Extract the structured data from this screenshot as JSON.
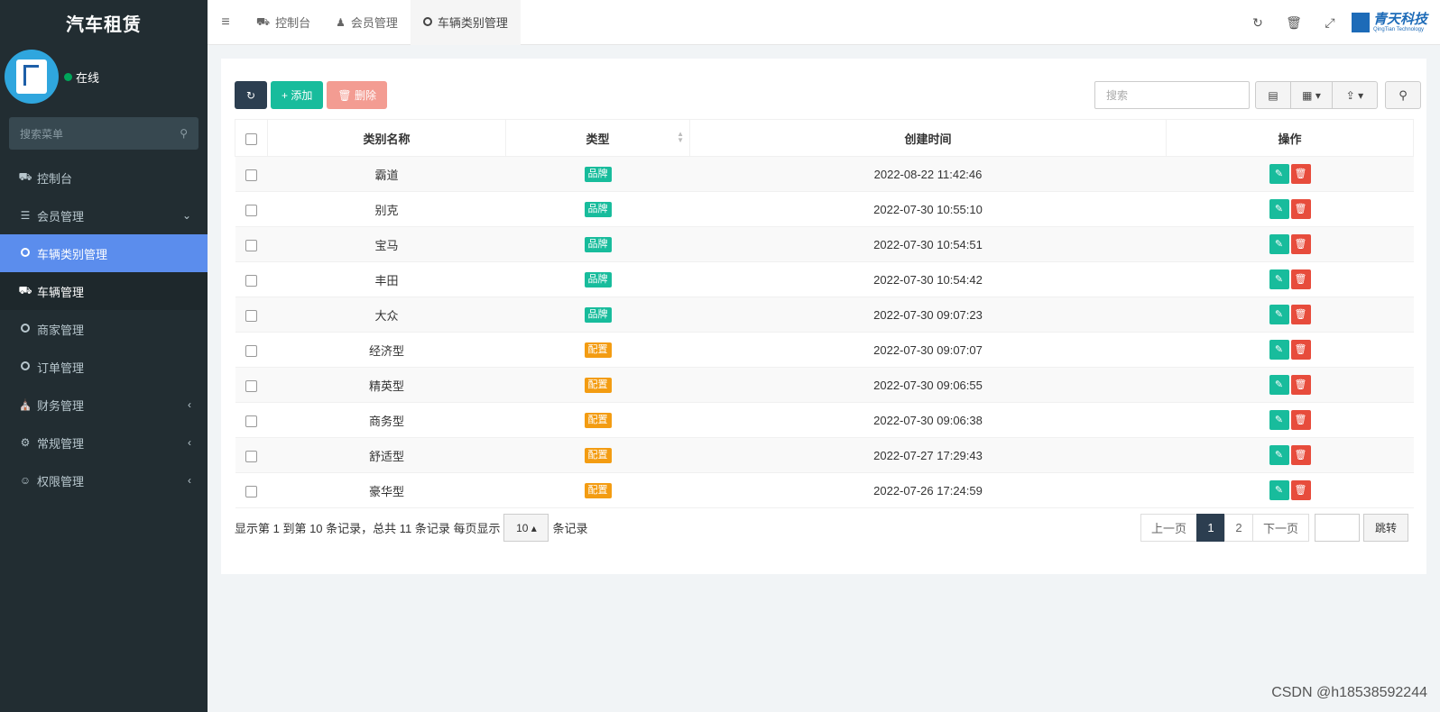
{
  "sidebar": {
    "brand": "汽车租赁",
    "status": "在线",
    "search_placeholder": "搜索菜单",
    "items": [
      {
        "label": "控制台"
      },
      {
        "label": "会员管理"
      },
      {
        "label": "车辆类别管理"
      },
      {
        "label": "车辆管理"
      },
      {
        "label": "商家管理"
      },
      {
        "label": "订单管理"
      },
      {
        "label": "财务管理"
      },
      {
        "label": "常规管理"
      },
      {
        "label": "权限管理"
      }
    ]
  },
  "topbar": {
    "tabs": [
      {
        "label": "控制台"
      },
      {
        "label": "会员管理"
      },
      {
        "label": "车辆类别管理"
      }
    ],
    "brand_name": "青天科技",
    "brand_en": "QingTian Technology"
  },
  "toolbar": {
    "add_label": "添加",
    "delete_label": "删除",
    "search_placeholder": "搜索"
  },
  "table": {
    "headers": [
      "类别名称",
      "类型",
      "创建时间",
      "操作"
    ],
    "rows": [
      {
        "name": "霸道",
        "type": "品牌",
        "time": "2022-08-22 11:42:46"
      },
      {
        "name": "别克",
        "type": "品牌",
        "time": "2022-07-30 10:55:10"
      },
      {
        "name": "宝马",
        "type": "品牌",
        "time": "2022-07-30 10:54:51"
      },
      {
        "name": "丰田",
        "type": "品牌",
        "time": "2022-07-30 10:54:42"
      },
      {
        "name": "大众",
        "type": "品牌",
        "time": "2022-07-30 09:07:23"
      },
      {
        "name": "经济型",
        "type": "配置",
        "time": "2022-07-30 09:07:07"
      },
      {
        "name": "精英型",
        "type": "配置",
        "time": "2022-07-30 09:06:55"
      },
      {
        "name": "商务型",
        "type": "配置",
        "time": "2022-07-30 09:06:38"
      },
      {
        "name": "舒适型",
        "type": "配置",
        "time": "2022-07-27 17:29:43"
      },
      {
        "name": "豪华型",
        "type": "配置",
        "time": "2022-07-26 17:24:59"
      }
    ],
    "type_colors": {
      "品牌": "#18bc9c",
      "配置": "#f39c12"
    }
  },
  "pagination": {
    "info_prefix": "显示第 1 到第 10 条记录，总共 11 条记录 每页显示",
    "page_size": "10",
    "info_suffix": "条记录",
    "prev": "上一页",
    "pages": [
      "1",
      "2"
    ],
    "next": "下一页",
    "jump": "跳转"
  },
  "watermark": "CSDN @h18538592244"
}
